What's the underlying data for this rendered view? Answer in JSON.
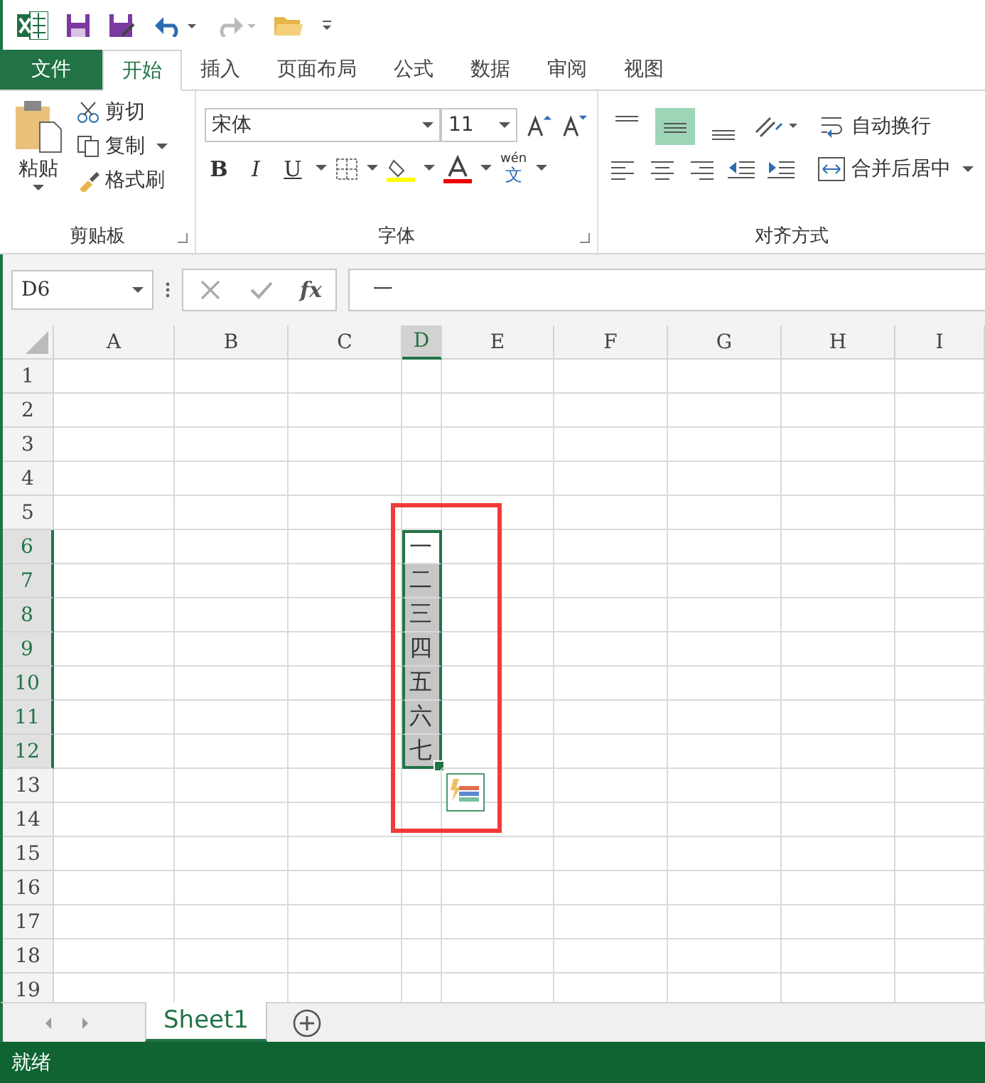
{
  "ribbon_tabs": [
    {
      "label": "文件",
      "kind": "file",
      "selected": false
    },
    {
      "label": "开始",
      "kind": "tab",
      "selected": true
    },
    {
      "label": "插入",
      "kind": "tab",
      "selected": false
    },
    {
      "label": "页面布局",
      "kind": "tab",
      "selected": false
    },
    {
      "label": "公式",
      "kind": "tab",
      "selected": false
    },
    {
      "label": "数据",
      "kind": "tab",
      "selected": false
    },
    {
      "label": "审阅",
      "kind": "tab",
      "selected": false
    },
    {
      "label": "视图",
      "kind": "tab",
      "selected": false
    }
  ],
  "clipboard": {
    "paste": "粘贴",
    "cut": "剪切",
    "copy": "复制",
    "format_painter": "格式刷",
    "group_label": "剪贴板"
  },
  "font": {
    "name": "宋体",
    "size": "11",
    "bold": "B",
    "italic": "I",
    "underline": "U",
    "phonetic_top": "wén",
    "phonetic_bottom": "文",
    "group_label": "字体"
  },
  "alignment": {
    "vertical": [
      {
        "selected": false
      },
      {
        "selected": true
      },
      {
        "selected": false
      }
    ],
    "wrap_text": "自动换行",
    "merge_center": "合并后居中",
    "group_label": "对齐方式"
  },
  "formula_bar": {
    "name_box": "D6",
    "fx": "fx",
    "value": "一"
  },
  "grid": {
    "columns": [
      {
        "label": "A",
        "selected": false
      },
      {
        "label": "B",
        "selected": false
      },
      {
        "label": "C",
        "selected": false
      },
      {
        "label": "D",
        "selected": true
      },
      {
        "label": "E",
        "selected": false
      },
      {
        "label": "F",
        "selected": false
      },
      {
        "label": "G",
        "selected": false
      },
      {
        "label": "H",
        "selected": false
      },
      {
        "label": "I",
        "selected": false
      }
    ],
    "rows": [
      {
        "label": "1",
        "selected": false
      },
      {
        "label": "2",
        "selected": false
      },
      {
        "label": "3",
        "selected": false
      },
      {
        "label": "4",
        "selected": false
      },
      {
        "label": "5",
        "selected": false
      },
      {
        "label": "6",
        "selected": true,
        "cells": [
          {
            "selected": false
          },
          {
            "selected": false
          },
          {
            "selected": false
          },
          {
            "text": "一",
            "selected": true,
            "active": true
          },
          {
            "selected": false
          },
          {
            "selected": false
          },
          {
            "selected": false
          },
          {
            "selected": false
          },
          {
            "selected": false
          }
        ]
      },
      {
        "label": "7",
        "selected": true,
        "cells": [
          {
            "selected": false
          },
          {
            "selected": false
          },
          {
            "selected": false
          },
          {
            "text": "二",
            "selected": true,
            "active": false
          },
          {
            "selected": false
          },
          {
            "selected": false
          },
          {
            "selected": false
          },
          {
            "selected": false
          },
          {
            "selected": false
          }
        ]
      },
      {
        "label": "8",
        "selected": true,
        "cells": [
          {
            "selected": false
          },
          {
            "selected": false
          },
          {
            "selected": false
          },
          {
            "text": "三",
            "selected": true,
            "active": false
          },
          {
            "selected": false
          },
          {
            "selected": false
          },
          {
            "selected": false
          },
          {
            "selected": false
          },
          {
            "selected": false
          }
        ]
      },
      {
        "label": "9",
        "selected": true,
        "cells": [
          {
            "selected": false
          },
          {
            "selected": false
          },
          {
            "selected": false
          },
          {
            "text": "四",
            "selected": true,
            "active": false
          },
          {
            "selected": false
          },
          {
            "selected": false
          },
          {
            "selected": false
          },
          {
            "selected": false
          },
          {
            "selected": false
          }
        ]
      },
      {
        "label": "10",
        "selected": true,
        "cells": [
          {
            "selected": false
          },
          {
            "selected": false
          },
          {
            "selected": false
          },
          {
            "text": "五",
            "selected": true,
            "active": false
          },
          {
            "selected": false
          },
          {
            "selected": false
          },
          {
            "selected": false
          },
          {
            "selected": false
          },
          {
            "selected": false
          }
        ]
      },
      {
        "label": "11",
        "selected": true,
        "cells": [
          {
            "selected": false
          },
          {
            "selected": false
          },
          {
            "selected": false
          },
          {
            "text": "六",
            "selected": true,
            "active": false
          },
          {
            "selected": false
          },
          {
            "selected": false
          },
          {
            "selected": false
          },
          {
            "selected": false
          },
          {
            "selected": false
          }
        ]
      },
      {
        "label": "12",
        "selected": true,
        "cells": [
          {
            "selected": false
          },
          {
            "selected": false
          },
          {
            "selected": false
          },
          {
            "text": "七",
            "selected": true,
            "active": false
          },
          {
            "selected": false
          },
          {
            "selected": false
          },
          {
            "selected": false
          },
          {
            "selected": false
          },
          {
            "selected": false
          }
        ]
      },
      {
        "label": "13",
        "selected": false
      },
      {
        "label": "14",
        "selected": false
      },
      {
        "label": "15",
        "selected": false
      },
      {
        "label": "16",
        "selected": false
      },
      {
        "label": "17",
        "selected": false
      },
      {
        "label": "18",
        "selected": false
      },
      {
        "label": "19",
        "selected": false
      }
    ]
  },
  "sheet_tabs": [
    {
      "label": "Sheet1",
      "selected": true
    }
  ],
  "status_bar": {
    "text": "就绪"
  }
}
